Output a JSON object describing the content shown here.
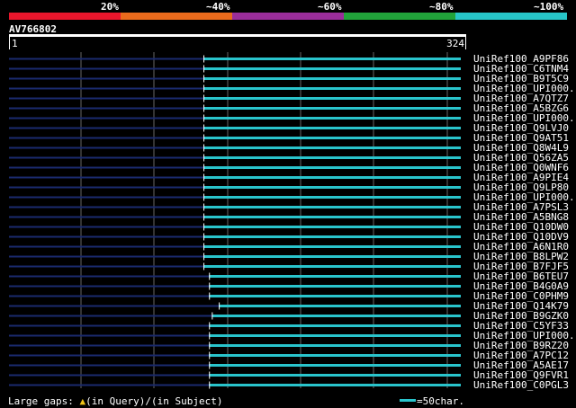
{
  "header": {
    "percent_labels": [
      "20%",
      "~40%",
      "~60%",
      "~80%",
      "~100%"
    ],
    "colors": [
      "#e8162c",
      "#ea6b1c",
      "#9a2d9a",
      "#21a33a",
      "#27c5c8"
    ]
  },
  "query": {
    "name": "AV766802",
    "start": "1",
    "end": "324",
    "length": 324
  },
  "hits": [
    {
      "label": "UniRef100_A9PF86",
      "start": 140,
      "end": 324
    },
    {
      "label": "UniRef100_C6TNM4",
      "start": 140,
      "end": 324
    },
    {
      "label": "UniRef100_B9T5C9",
      "start": 140,
      "end": 324
    },
    {
      "label": "UniRef100_UPI000..",
      "start": 140,
      "end": 324
    },
    {
      "label": "UniRef100_A7QTZ7",
      "start": 140,
      "end": 324
    },
    {
      "label": "UniRef100_A5BZG6",
      "start": 140,
      "end": 324
    },
    {
      "label": "UniRef100_UPI000..",
      "start": 140,
      "end": 324
    },
    {
      "label": "UniRef100_Q9LVJ0",
      "start": 140,
      "end": 324
    },
    {
      "label": "UniRef100_Q9AT51",
      "start": 140,
      "end": 324
    },
    {
      "label": "UniRef100_Q8W4L9",
      "start": 140,
      "end": 324
    },
    {
      "label": "UniRef100_Q56ZA5",
      "start": 140,
      "end": 324
    },
    {
      "label": "UniRef100_Q0WNF6",
      "start": 140,
      "end": 324
    },
    {
      "label": "UniRef100_A9PIE4",
      "start": 140,
      "end": 324
    },
    {
      "label": "UniRef100_Q9LP80",
      "start": 140,
      "end": 324
    },
    {
      "label": "UniRef100_UPI000..",
      "start": 140,
      "end": 324
    },
    {
      "label": "UniRef100_A7PSL3",
      "start": 140,
      "end": 324
    },
    {
      "label": "UniRef100_A5BNG8",
      "start": 140,
      "end": 324
    },
    {
      "label": "UniRef100_Q10DW0",
      "start": 140,
      "end": 324
    },
    {
      "label": "UniRef100_Q10DV9",
      "start": 140,
      "end": 324
    },
    {
      "label": "UniRef100_A6N1R0",
      "start": 140,
      "end": 324
    },
    {
      "label": "UniRef100_B8LPW2",
      "start": 140,
      "end": 324
    },
    {
      "label": "UniRef100_B7FJF5",
      "start": 140,
      "end": 324
    },
    {
      "label": "UniRef100_B6TEU7",
      "start": 144,
      "end": 324
    },
    {
      "label": "UniRef100_B4G0A9",
      "start": 144,
      "end": 324
    },
    {
      "label": "UniRef100_C0PHM9",
      "start": 144,
      "end": 324
    },
    {
      "label": "UniRef100_Q14K79",
      "start": 151,
      "end": 324
    },
    {
      "label": "UniRef100_B9GZK0",
      "start": 146,
      "end": 324
    },
    {
      "label": "UniRef100_C5YF33",
      "start": 144,
      "end": 324
    },
    {
      "label": "UniRef100_UPI000..",
      "start": 144,
      "end": 324
    },
    {
      "label": "UniRef100_B9RZ20",
      "start": 144,
      "end": 324
    },
    {
      "label": "UniRef100_A7PC12",
      "start": 144,
      "end": 324
    },
    {
      "label": "UniRef100_A5AE17",
      "start": 144,
      "end": 324
    },
    {
      "label": "UniRef100_Q9FVR1",
      "start": 144,
      "end": 324
    },
    {
      "label": "UniRef100_C0PGL3",
      "start": 144,
      "end": 324
    }
  ],
  "footer": {
    "gaps_prefix": "Large gaps: ",
    "gaps_query": "(in Query)/",
    "gaps_subject": "(in Subject)",
    "scale_label": "=50char."
  },
  "palette": {
    "hit": "#29c4cc",
    "gap": "#1a2a6e",
    "grid": "#666666"
  }
}
